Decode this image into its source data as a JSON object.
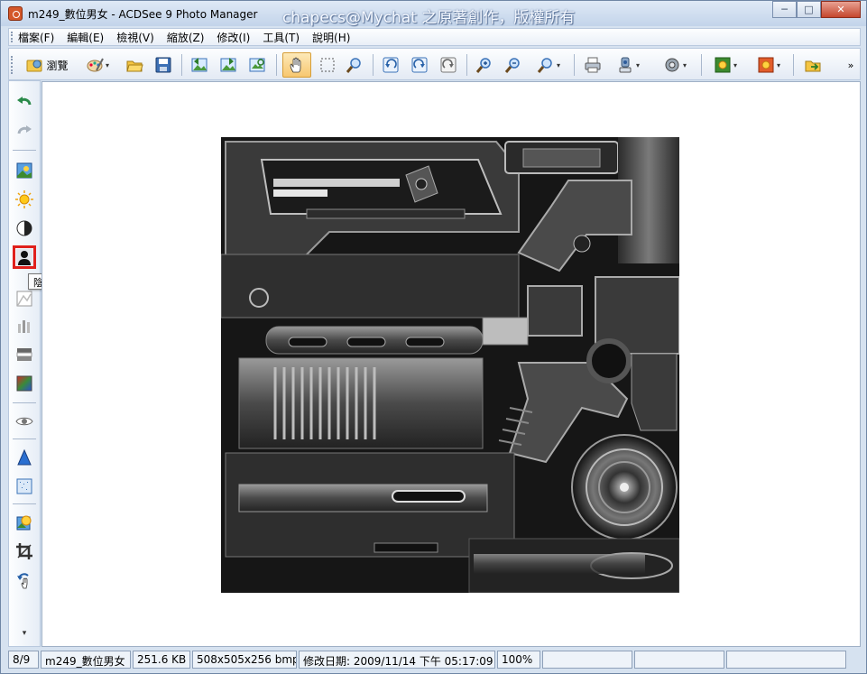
{
  "window": {
    "title": "m249_數位男女 - ACDSee 9 Photo Manager",
    "watermark": "chapecs@Mychat 之原著創作，版權所有",
    "controls": {
      "minimize": "─",
      "maximize": "□",
      "close": "✕"
    }
  },
  "menu": {
    "items": [
      {
        "label": "檔案(F)"
      },
      {
        "label": "編輯(E)"
      },
      {
        "label": "檢視(V)"
      },
      {
        "label": "縮放(Z)"
      },
      {
        "label": "修改(I)"
      },
      {
        "label": "工具(T)"
      },
      {
        "label": "說明(H)"
      }
    ]
  },
  "toolbar": {
    "browse_label": "瀏覽",
    "overflow": "»",
    "icons": [
      "browse-icon",
      "edit-palette-icon",
      "open-folder-icon",
      "save-icon",
      "prev-image-icon",
      "next-image-icon",
      "auto-advance-icon",
      "hand-pan-icon",
      "select-marquee-icon",
      "magnifier-icon",
      "rotate-left-icon",
      "rotate-right-icon",
      "rotate-auto-icon",
      "zoom-in-icon",
      "zoom-out-icon",
      "zoom-select-icon",
      "print-icon",
      "acquire-icon",
      "audio-icon",
      "wallpaper-center-icon",
      "wallpaper-tile-icon",
      "export-icon"
    ]
  },
  "leftbar": {
    "tooltip": "陰影/加亮",
    "icons": [
      "undo-icon",
      "redo-icon",
      "auto-exposure-icon",
      "exposure-icon",
      "contrast-icon",
      "shadow-highlight-icon",
      "levels-icon",
      "curves-icon",
      "histogram-icon",
      "color-balance-icon",
      "red-eye-icon",
      "sharpen-icon",
      "noise-icon",
      "effects-icon",
      "crop-icon",
      "rotate-hand-icon"
    ]
  },
  "status": {
    "index": "8/9",
    "filename": "m249_數位男女",
    "filesize": "251.6 KB",
    "dimensions": "508x505x256 bmp",
    "modified": "修改日期: 2009/11/14 下午 05:17:09",
    "zoom": "100%"
  },
  "colors": {
    "highlight_border": "#e0201b",
    "title_bar": "#c3d4ea",
    "viewer_bg": "#ffffff"
  }
}
